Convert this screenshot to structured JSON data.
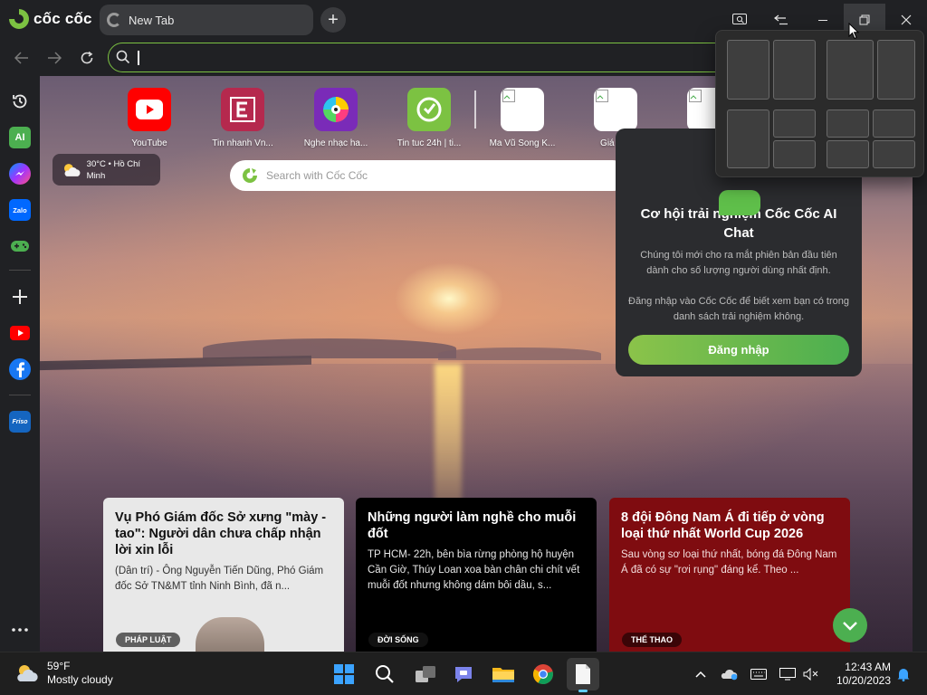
{
  "browser": {
    "brand": "cốc cốc",
    "tab": {
      "title": "New Tab"
    },
    "address": {
      "value": ""
    },
    "accent": "#7cc242"
  },
  "sidebar": {
    "items": [
      {
        "name": "history-icon"
      },
      {
        "name": "ai-icon",
        "label": "AI"
      },
      {
        "name": "messenger-icon"
      },
      {
        "name": "zalo-icon",
        "label": "Zalo"
      },
      {
        "name": "game-icon"
      },
      {
        "name": "add-icon"
      },
      {
        "name": "youtube-icon"
      },
      {
        "name": "facebook-icon"
      },
      {
        "name": "friso-icon",
        "label": "Friso"
      },
      {
        "name": "more-icon"
      }
    ]
  },
  "speed_dial": [
    {
      "label": "YouTube",
      "icon": "youtube-icon",
      "color": "#ff0000"
    },
    {
      "label": "Tin nhanh Vn...",
      "icon": "e-letter-icon",
      "color": "#b5294e"
    },
    {
      "label": "Nghe nhạc ha...",
      "icon": "music-disc-icon",
      "color": "#7a2bb8"
    },
    {
      "label": "Tin tuc 24h | ti...",
      "icon": "clock-icon",
      "color": "#7cc242"
    },
    {
      "label": "Ma Vũ Song K...",
      "icon": "broken-image-icon",
      "color": "#ffffff"
    },
    {
      "label": "Giá sốc",
      "icon": "broken-image-icon",
      "color": "#ffffff"
    },
    {
      "label": "",
      "icon": "broken-image-icon",
      "color": "#ffffff"
    }
  ],
  "weather_widget": {
    "text": "30°C • Hồ Chí Minh"
  },
  "search": {
    "placeholder": "Search with Cốc Cốc"
  },
  "promo": {
    "title": "Cơ hội trải nghiệm Cốc Cốc AI Chat",
    "body1": "Chúng tôi mới cho ra mắt phiên bản đầu tiên dành cho số lượng người dùng nhất định.",
    "body2": "Đăng nhập vào Cốc Cốc để biết xem bạn có trong danh sách trải nghiệm không.",
    "button": "Đăng nhập"
  },
  "news": [
    {
      "title": "Vụ Phó Giám đốc Sở xưng \"mày - tao\": Người dân chưa chấp nhận lời xin lỗi",
      "snippet": "(Dân trí) - Ông Nguyễn Tiến Dũng, Phó Giám đốc Sở TN&MT tỉnh Ninh Bình, đã n...",
      "tag": "PHÁP LUẬT",
      "bg": "#e8e8e8"
    },
    {
      "title": "Những người làm nghề cho muỗi đốt",
      "snippet": "TP HCM- 22h, bên bìa rừng phòng hộ huyện Cần Giờ, Thúy Loan xoa bàn chân chi chít vết muỗi đốt nhưng không dám bôi dầu, s...",
      "tag": "ĐỜI SỐNG",
      "bg": "#000000"
    },
    {
      "title": "8 đội Đông Nam Á đi tiếp ở vòng loại thứ nhất World Cup 2026",
      "snippet": "Sau vòng sơ loại thứ nhất, bóng đá Đông Nam Á đã có sự \"rơi rụng\" đáng kể. Theo ...",
      "tag": "THỂ THAO",
      "bg": "#7f0c10"
    }
  ],
  "taskbar": {
    "weather": {
      "temp": "59°F",
      "condition": "Mostly cloudy"
    },
    "clock": {
      "time": "12:43 AM",
      "date": "10/20/2023"
    },
    "apps": [
      "windows-start-icon",
      "search-icon",
      "task-view-icon",
      "teams-chat-icon",
      "file-explorer-icon",
      "chrome-icon",
      "notepad-icon"
    ]
  }
}
